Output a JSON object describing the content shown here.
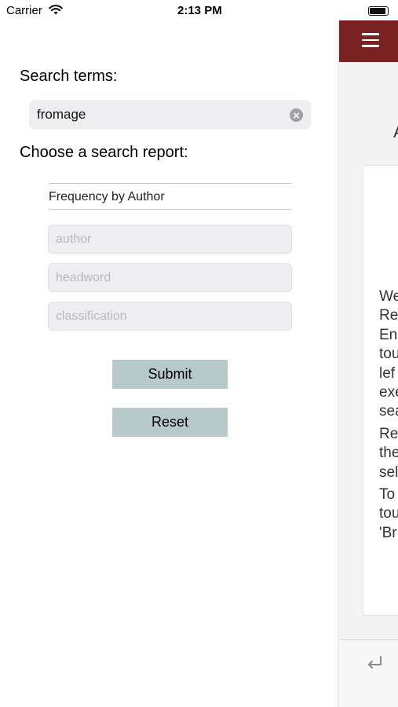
{
  "status_bar": {
    "carrier": "Carrier",
    "time": "2:13 PM"
  },
  "search": {
    "label": "Search terms:",
    "value": "fromage"
  },
  "report": {
    "label": "Choose a search report:",
    "selected": "Frequency by Author"
  },
  "filters": {
    "author_placeholder": "author",
    "headword_placeholder": "headword",
    "classification_placeholder": "classification"
  },
  "buttons": {
    "submit": "Submit",
    "reset": "Reset"
  },
  "right_panel": {
    "heading_fragment": "A",
    "text_fragments": [
      "We",
      "Re",
      "En",
      "tou",
      "lef",
      "exe",
      "sea",
      "Re",
      "the",
      "sel",
      "To",
      "tou",
      "'Br"
    ],
    "nav_color": "#7a2222"
  }
}
